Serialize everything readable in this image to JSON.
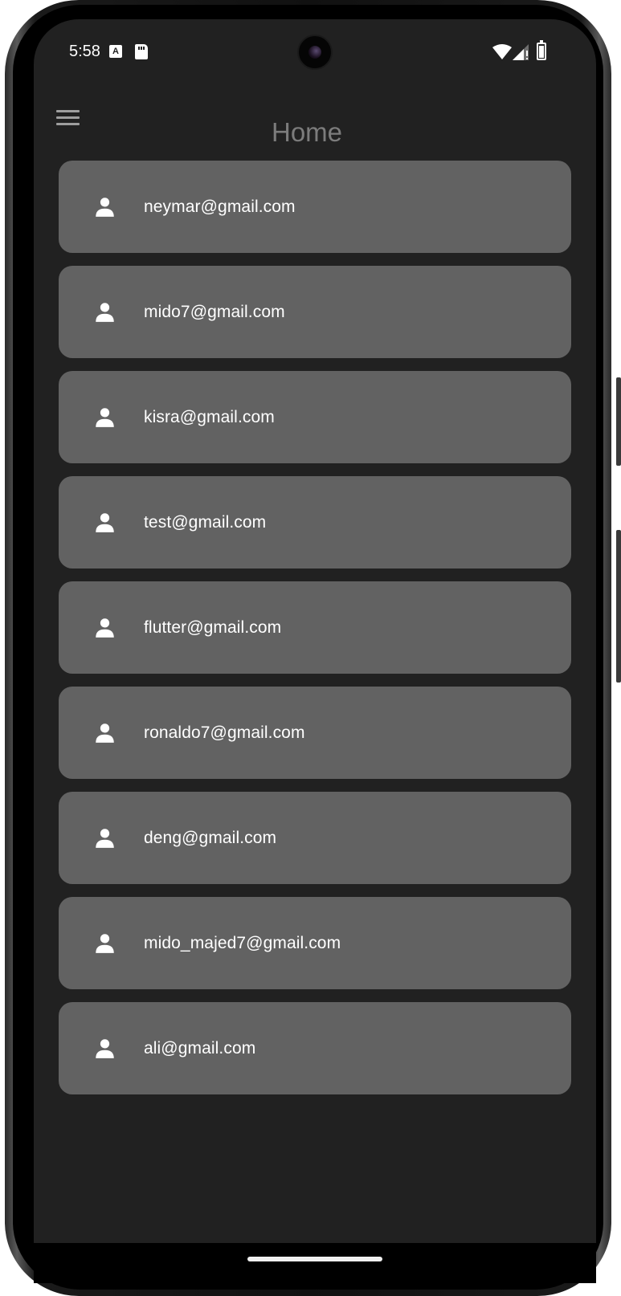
{
  "status_bar": {
    "time": "5:58",
    "notification_icons": [
      "accessibility-a-icon",
      "sd-card-icon"
    ],
    "system_icons": [
      "wifi-icon",
      "cell-signal-icon",
      "battery-icon"
    ]
  },
  "app_bar": {
    "title": "Home",
    "menu_icon": "menu-icon"
  },
  "users": [
    {
      "email": "neymar@gmail.com",
      "icon": "person-icon"
    },
    {
      "email": "mido7@gmail.com",
      "icon": "person-icon"
    },
    {
      "email": "kisra@gmail.com",
      "icon": "person-icon"
    },
    {
      "email": "test@gmail.com",
      "icon": "person-icon"
    },
    {
      "email": "flutter@gmail.com",
      "icon": "person-icon"
    },
    {
      "email": "ronaldo7@gmail.com",
      "icon": "person-icon"
    },
    {
      "email": "deng@gmail.com",
      "icon": "person-icon"
    },
    {
      "email": "mido_majed7@gmail.com",
      "icon": "person-icon"
    },
    {
      "email": "ali@gmail.com",
      "icon": "person-icon"
    }
  ],
  "colors": {
    "background": "#212121",
    "card": "#626262",
    "title": "#7c7c7c",
    "text": "#ffffff"
  }
}
